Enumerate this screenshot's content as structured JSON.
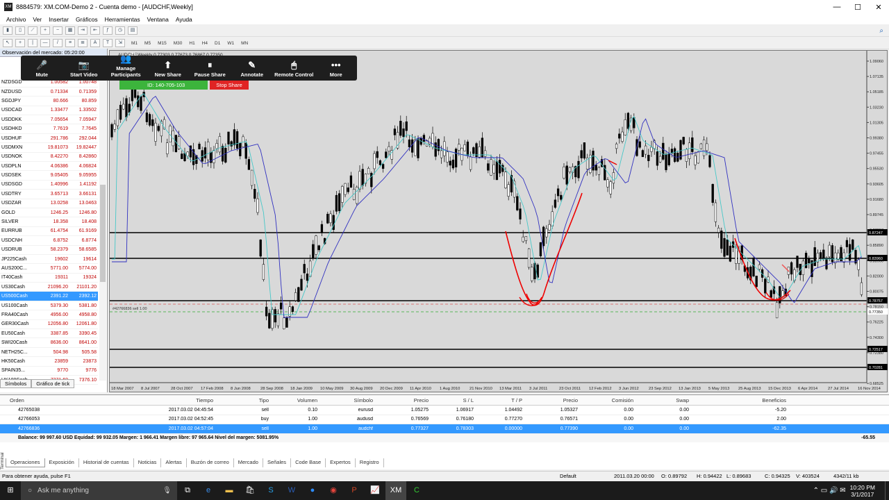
{
  "window": {
    "title": "8884579: XM.COM-Demo 2 - Cuenta demo - [AUDCHF,Weekly]",
    "minimize": "—",
    "maximize": "☐",
    "close": "✕"
  },
  "menu": [
    "Archivo",
    "Ver",
    "Insertar",
    "Gráficos",
    "Herramientas",
    "Ventana",
    "Ayuda"
  ],
  "timeframes": [
    "M1",
    "M5",
    "M15",
    "M30",
    "H1",
    "H4",
    "D1",
    "W1",
    "MN"
  ],
  "market_watch": {
    "header": "Observación del mercado: 05:20:00",
    "rows": [
      [
        "NZDSGD",
        "1.00582",
        "1.00748"
      ],
      [
        "NZDUSD",
        "0.71334",
        "0.71359"
      ],
      [
        "SGDJPY",
        "80.666",
        "80.859"
      ],
      [
        "USDCAD",
        "1.33477",
        "1.33502"
      ],
      [
        "USDDKK",
        "7.05654",
        "7.05947"
      ],
      [
        "USDHKD",
        "7.7619",
        "7.7645"
      ],
      [
        "USDHUF",
        "291.786",
        "292.044"
      ],
      [
        "USDMXN",
        "19.81073",
        "19.82447"
      ],
      [
        "USDNOK",
        "8.42270",
        "8.42860"
      ],
      [
        "USDPLN",
        "4.06386",
        "4.06824"
      ],
      [
        "USDSEK",
        "9.05405",
        "9.05955"
      ],
      [
        "USDSGD",
        "1.40996",
        "1.41192"
      ],
      [
        "USDTRY",
        "3.65713",
        "3.66131"
      ],
      [
        "USDZAR",
        "13.0258",
        "13.0463"
      ],
      [
        "GOLD",
        "1246.25",
        "1246.80"
      ],
      [
        "SILVER",
        "18.358",
        "18.408"
      ],
      [
        "EURRUB",
        "61.4754",
        "61.9169"
      ],
      [
        "USDCNH",
        "6.8752",
        "6.8774"
      ],
      [
        "USDRUB",
        "58.2379",
        "58.6585"
      ],
      [
        "JP225Cash",
        "19602",
        "19614"
      ],
      [
        "AUS200C...",
        "5771.00",
        "5774.00"
      ],
      [
        "IT40Cash",
        "19311",
        "19324"
      ],
      [
        "US30Cash",
        "21096.20",
        "21101.20"
      ],
      [
        "US500Cash",
        "2391.22",
        "2392.12"
      ],
      [
        "US100Cash",
        "5379.30",
        "5381.80"
      ],
      [
        "FRA40Cash",
        "4956.00",
        "4958.80"
      ],
      [
        "GER30Cash",
        "12056.80",
        "12061.80"
      ],
      [
        "EU50Cash",
        "3387.85",
        "3390.45"
      ],
      [
        "SWI20Cash",
        "8636.00",
        "8641.00"
      ],
      [
        "NETH25C...",
        "504.98",
        "505.58"
      ],
      [
        "HK50Cash",
        "23859",
        "23873"
      ],
      [
        "SPAIN35...",
        "9770",
        "9776"
      ],
      [
        "UK100Cash",
        "7371.60",
        "7376.10"
      ]
    ],
    "selected_row": 23,
    "tabs": [
      "Símbolos",
      "Gráfico de tick"
    ]
  },
  "chart": {
    "header": "AUDCHF,Weekly  0.77303 0.77673 0.76867 0.77350",
    "order_label": "#42766836 sell 1.00",
    "price_axis": [
      "1.09060",
      "1.07135",
      "1.05185",
      "1.03230",
      "1.01305",
      "0.99380",
      "0.97455",
      "0.95530",
      "0.93605",
      "0.91680",
      "0.89745",
      "0.87807",
      "0.85890",
      "0.83960",
      "0.82000",
      "0.80075",
      "0.78150",
      "0.76225",
      "0.74300",
      "0.72380",
      "0.70455",
      "0.68525"
    ],
    "price_tags": [
      "0.87247",
      "0.83960",
      "0.78757",
      "0.77350",
      "0.72517",
      "0.70281"
    ],
    "date_axis": [
      "18 Mar 2007",
      "8 Jul 2007",
      "28 Oct 2007",
      "17 Feb 2008",
      "8 Jun 2008",
      "28 Sep 2008",
      "18 Jan 2009",
      "10 May 2009",
      "30 Aug 2009",
      "20 Dec 2009",
      "11 Apr 2010",
      "1 Aug 2010",
      "21 Nov 2010",
      "13 Mar 2011",
      "3 Jul 2011",
      "23 Oct 2011",
      "12 Feb 2012",
      "3 Jun 2012",
      "23 Sep 2012",
      "13 Jan 2013",
      "5 May 2013",
      "25 Aug 2013",
      "15 Dec 2013",
      "6 Apr 2014",
      "27 Jul 2014",
      "16 Nov 2014"
    ]
  },
  "zoom": {
    "buttons": [
      [
        "Mute",
        "🎤"
      ],
      [
        "Start Video",
        "📷"
      ],
      [
        "Manage Participants",
        "👥"
      ],
      [
        "New Share",
        "⬆"
      ],
      [
        "Pause Share",
        "⏸"
      ],
      [
        "Annotate",
        "✎"
      ],
      [
        "Remote Control",
        "🖱"
      ],
      [
        "More",
        "•••"
      ]
    ],
    "participants": "21",
    "meeting_id": "ID: 140-705-103",
    "stop_share": "Stop Share"
  },
  "terminal": {
    "headers": [
      "Orden",
      "Tiempo",
      "Tipo",
      "Volumen",
      "Símbolo",
      "Precio",
      "S / L",
      "T / P",
      "Precio",
      "Comisión",
      "Swap",
      "Beneficios"
    ],
    "rows": [
      [
        "42765038",
        "2017.03.02 04:45:54",
        "sell",
        "0.10",
        "eurusd",
        "1.05275",
        "1.06917",
        "1.04492",
        "1.05327",
        "0.00",
        "0.00",
        "-5.20"
      ],
      [
        "42766053",
        "2017.03.02 04:52:45",
        "buy",
        "1.00",
        "audusd",
        "0.76569",
        "0.76180",
        "0.77270",
        "0.76571",
        "0.00",
        "0.00",
        "2.00"
      ],
      [
        "42766836",
        "2017.03.02 04:57:04",
        "sell",
        "1.00",
        "audchf",
        "0.77327",
        "0.78303",
        "0.00000",
        "0.77390",
        "0.00",
        "0.00",
        "-62.35"
      ]
    ],
    "balance": "Balance: 99 997.60 USD  Equidad: 99 932.05  Margen: 1 966.41  Margen libre: 97 965.64  Nivel del margen: 5081.95%",
    "balance_total": "-65.55",
    "tabs": [
      "Operaciones",
      "Exposición",
      "Historial de cuentas",
      "Noticias",
      "Alertas",
      "Buzón de correo",
      "Mercado",
      "Señales",
      "Code Base",
      "Expertos",
      "Registro"
    ],
    "side_label": "Terminal"
  },
  "status": {
    "help": "Para obtener ayuda, pulse F1",
    "profile": "Default",
    "time": "2011.03.20 00:00",
    "open": "O: 0.89792",
    "high": "H: 0.94422",
    "low": "L: 0.89683",
    "close": "C: 0.94325",
    "volume": "V: 403524",
    "traffic": "4342/11 kb"
  },
  "taskbar": {
    "search_placeholder": "Ask me anything",
    "clock_time": "10:20 PM",
    "clock_date": "3/1/2017"
  }
}
